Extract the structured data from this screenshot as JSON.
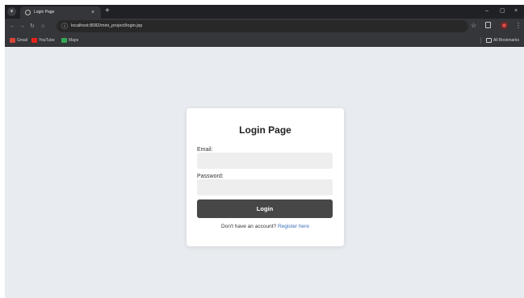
{
  "browser": {
    "tab": {
      "title": "Login Page",
      "close_glyph": "×",
      "favicon_icon": "globe-icon"
    },
    "new_tab_glyph": "+",
    "window_controls": {
      "minimize": "–",
      "maximize": "▢",
      "close": "×"
    },
    "toolbar": {
      "back_glyph": "←",
      "forward_glyph": "→",
      "reload_glyph": "↻",
      "home_glyph": "⌂",
      "site_info_glyph": "ⓘ",
      "url": "localhost:8082/mini_project/login.jsp",
      "star_glyph": "☆",
      "menu_glyph": "⋮"
    },
    "bookmarks": [
      {
        "label": "Gmail",
        "icon": "gmail-icon",
        "color": "#d44638"
      },
      {
        "label": "YouTube",
        "icon": "youtube-icon",
        "color": "#e62117"
      },
      {
        "label": "Maps",
        "icon": "maps-icon",
        "color": "#34a853"
      }
    ],
    "all_bookmarks": {
      "label": "All Bookmarks",
      "icon": "folder-icon"
    }
  },
  "login": {
    "title": "Login Page",
    "email_label": "Email:",
    "email_value": "",
    "password_label": "Password:",
    "password_value": "",
    "submit_label": "Login",
    "register_prompt": "Don't have an account?",
    "register_link": "Register here"
  },
  "colors": {
    "page_background": "#e8ebef",
    "button": "#474747",
    "link": "#3b6fb6",
    "input_background": "#eeeeee"
  }
}
